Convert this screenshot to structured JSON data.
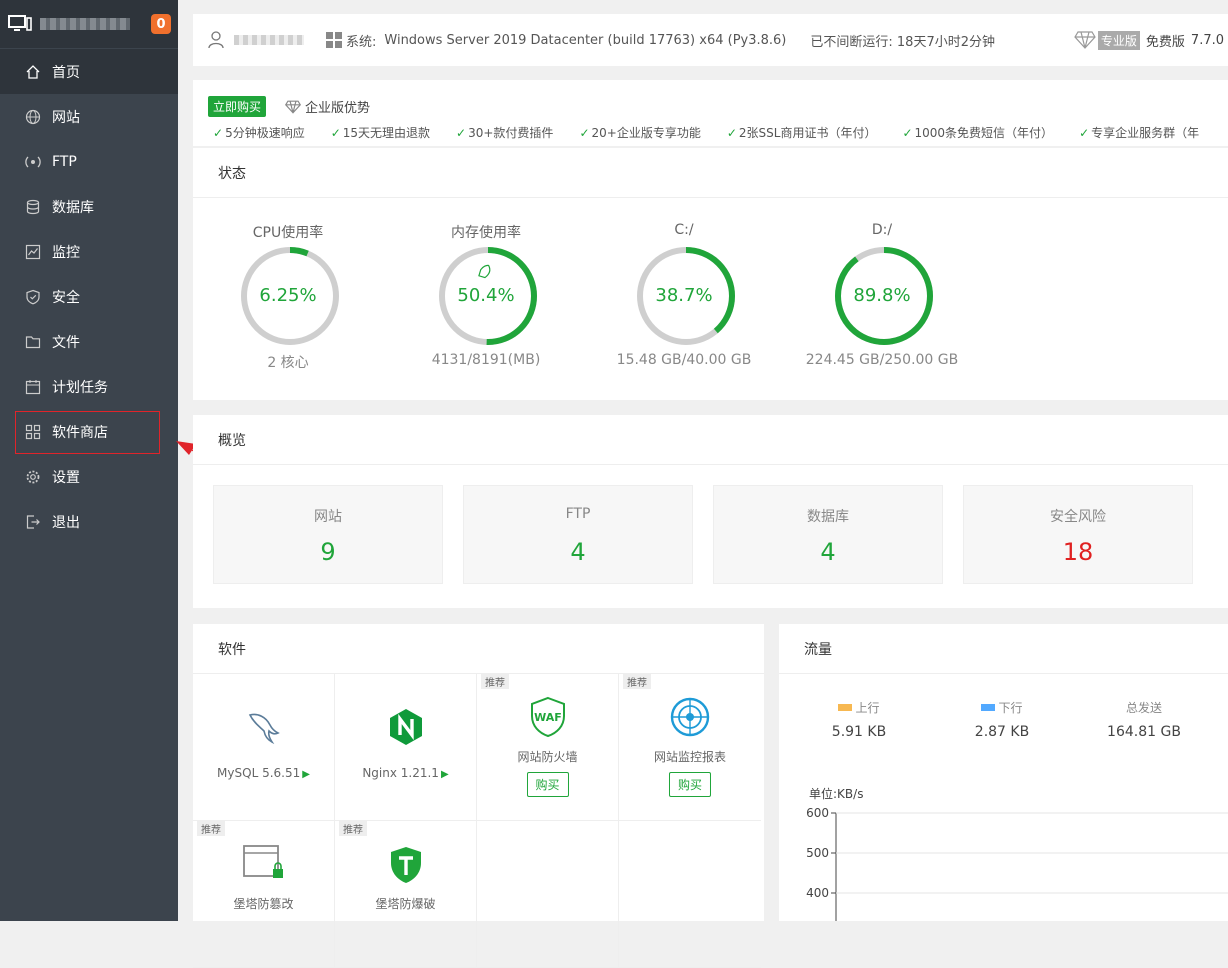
{
  "sidebar": {
    "badge": "0",
    "items": [
      {
        "label": "首页",
        "icon": "home-icon"
      },
      {
        "label": "网站",
        "icon": "globe-icon"
      },
      {
        "label": "FTP",
        "icon": "ftp-icon"
      },
      {
        "label": "数据库",
        "icon": "database-icon"
      },
      {
        "label": "监控",
        "icon": "monitor-icon"
      },
      {
        "label": "安全",
        "icon": "shield-icon"
      },
      {
        "label": "文件",
        "icon": "folder-icon"
      },
      {
        "label": "计划任务",
        "icon": "calendar-icon"
      },
      {
        "label": "软件商店",
        "icon": "grid-icon"
      },
      {
        "label": "设置",
        "icon": "gear-icon"
      },
      {
        "label": "退出",
        "icon": "logout-icon"
      }
    ]
  },
  "topbar": {
    "sys_label": "系统:",
    "sys_value": "Windows Server 2019 Datacenter (build 17763) x64 (Py3.8.6)",
    "uptime": "已不间断运行: 18天7小时2分钟",
    "pro_tag": "专业版",
    "free": "免费版",
    "version": "7.7.0"
  },
  "promo": {
    "buy": "立即购买",
    "enterprise": "企业版优势",
    "features": [
      "5分钟极速响应",
      "15天无理由退款",
      "30+款付费插件",
      "20+企业版专享功能",
      "2张SSL商用证书（年付）",
      "1000条免费短信（年付）",
      "专享企业服务群（年"
    ]
  },
  "status": {
    "title": "状态",
    "gauges": [
      {
        "title": "CPU使用率",
        "value": "6.25%",
        "sub": "2 核心",
        "percent": 6.25
      },
      {
        "title": "内存使用率",
        "value": "50.4%",
        "sub": "4131/8191(MB)",
        "percent": 50.4
      },
      {
        "title": "C:/",
        "value": "38.7%",
        "sub": "15.48 GB/40.00 GB",
        "percent": 38.7
      },
      {
        "title": "D:/",
        "value": "89.8%",
        "sub": "224.45 GB/250.00 GB",
        "percent": 89.8
      }
    ]
  },
  "overview": {
    "title": "概览",
    "items": [
      {
        "label": "网站",
        "value": "9"
      },
      {
        "label": "FTP",
        "value": "4"
      },
      {
        "label": "数据库",
        "value": "4"
      },
      {
        "label": "安全风险",
        "value": "18"
      }
    ]
  },
  "software": {
    "title": "软件",
    "recommend": "推荐",
    "buy": "购买",
    "items": [
      {
        "name": "MySQL 5.6.51",
        "icon": "mysql-dolphin-icon"
      },
      {
        "name": "Nginx 1.21.1",
        "icon": "nginx-icon"
      },
      {
        "name": "网站防火墙",
        "icon": "waf-shield-icon",
        "badge_text": "WAF"
      },
      {
        "name": "网站监控报表",
        "icon": "radar-icon"
      },
      {
        "name": "堡塔防篡改",
        "icon": "browser-lock-icon"
      },
      {
        "name": "堡塔防爆破",
        "icon": "hammer-shield-icon"
      }
    ]
  },
  "traffic": {
    "title": "流量",
    "up_label": "上行",
    "up_value": "5.91 KB",
    "down_label": "下行",
    "down_value": "2.87 KB",
    "total_label": "总发送",
    "total_value": "164.81 GB",
    "unit": "单位:KB/s",
    "colors": {
      "up": "#f7b851",
      "down": "#52a9ff"
    }
  },
  "chart_data": {
    "type": "line",
    "ylabel": "单位:KB/s",
    "yticks": [
      "600",
      "500",
      "400"
    ],
    "ylim": [
      400,
      600
    ]
  }
}
